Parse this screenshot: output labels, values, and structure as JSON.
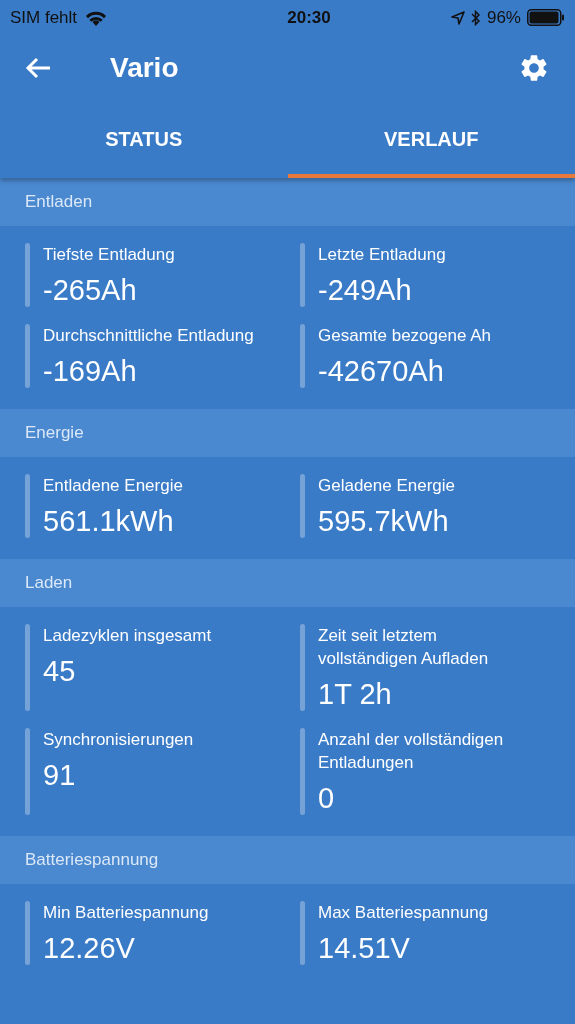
{
  "status_bar": {
    "carrier": "SIM fehlt",
    "time": "20:30",
    "battery_percent": "96%"
  },
  "app_bar": {
    "title": "Vario"
  },
  "tabs": [
    {
      "label": "STATUS",
      "selected": false
    },
    {
      "label": "VERLAUF",
      "selected": true
    }
  ],
  "sections": [
    {
      "title": "Entladen",
      "items": [
        {
          "label": "Tiefste Entladung",
          "value": "-265Ah"
        },
        {
          "label": "Letzte Entladung",
          "value": "-249Ah"
        },
        {
          "label": "Durchschnittliche Entladung",
          "value": "-169Ah"
        },
        {
          "label": "Gesamte bezogene Ah",
          "value": "-42670Ah"
        }
      ]
    },
    {
      "title": "Energie",
      "items": [
        {
          "label": "Entladene Energie",
          "value": "561.1kWh"
        },
        {
          "label": "Geladene Energie",
          "value": "595.7kWh"
        }
      ]
    },
    {
      "title": "Laden",
      "items": [
        {
          "label": "Ladezyklen insgesamt",
          "value": "45"
        },
        {
          "label": "Zeit seit letztem vollständigen Aufladen",
          "value": "1T 2h"
        },
        {
          "label": "Synchronisierungen",
          "value": "91"
        },
        {
          "label": "Anzahl der vollständigen Entladungen",
          "value": "0"
        }
      ]
    },
    {
      "title": "Batteriespannung",
      "items": [
        {
          "label": "Min Batteriespannung",
          "value": "12.26V"
        },
        {
          "label": "Max Batteriespannung",
          "value": "14.51V"
        }
      ]
    }
  ]
}
